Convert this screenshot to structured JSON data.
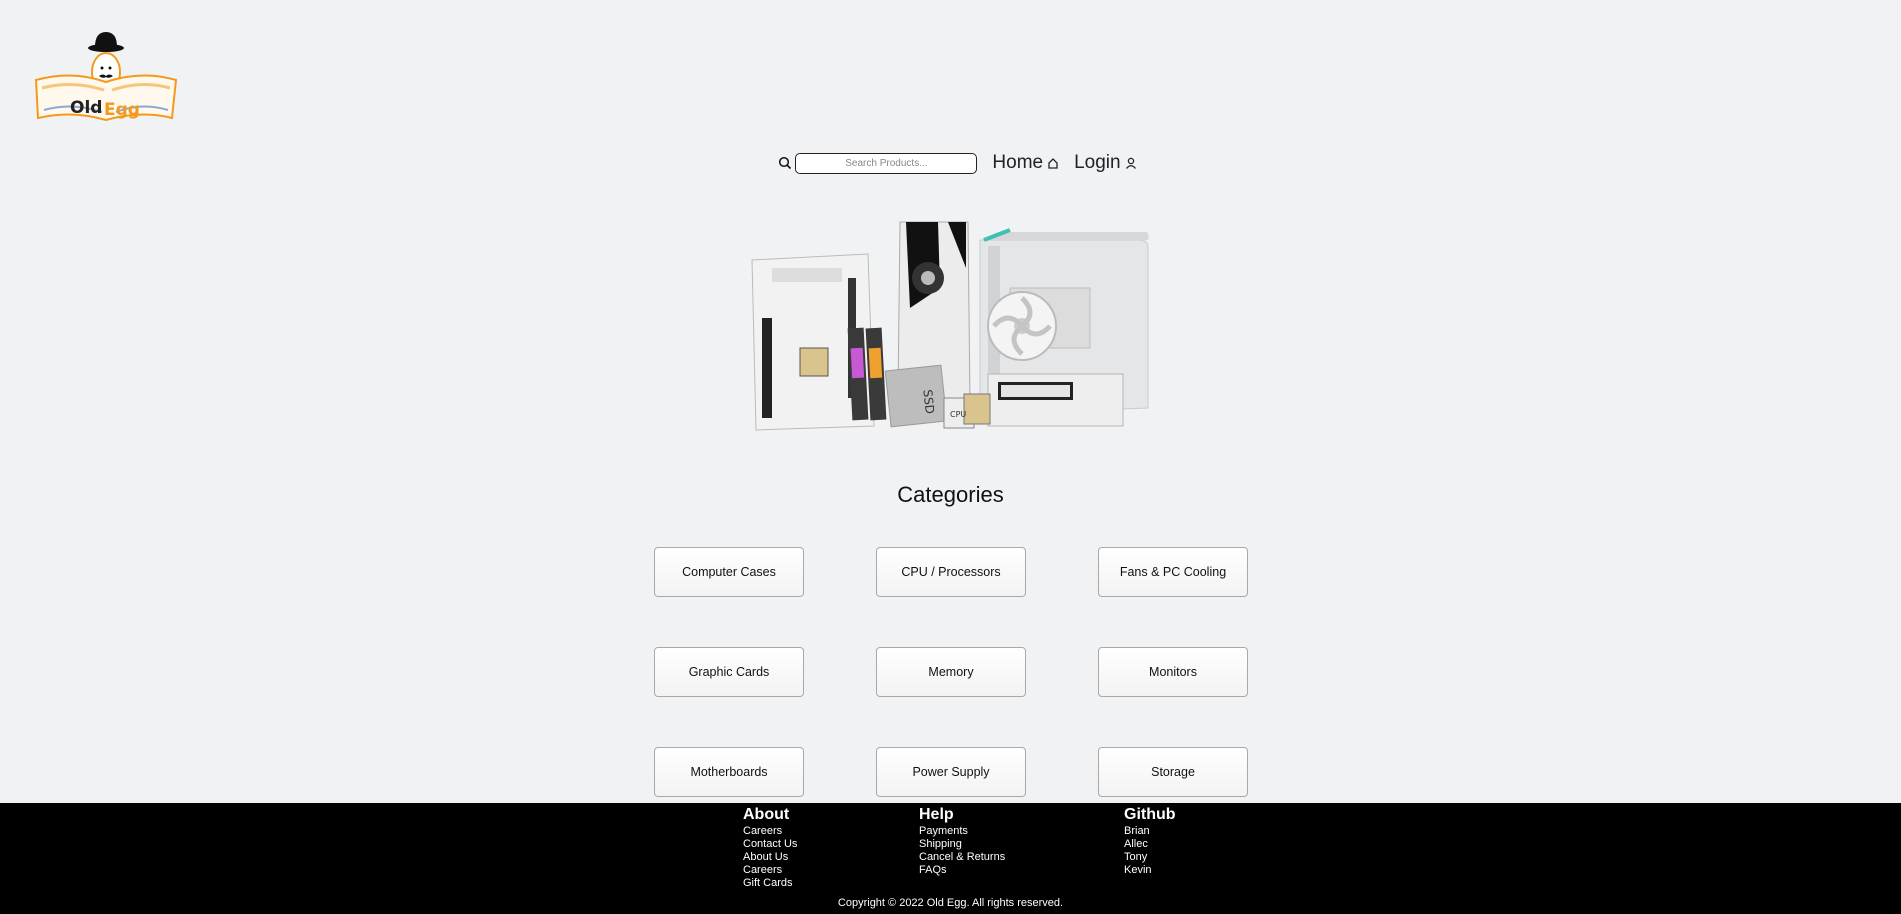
{
  "brand": {
    "name_part1": "Old",
    "name_part2": "Egg"
  },
  "nav": {
    "search_placeholder": "Search Products...",
    "home_label": "Home",
    "login_label": "Login"
  },
  "categories": {
    "title": "Categories",
    "items": [
      "Computer Cases",
      "CPU / Processors",
      "Fans & PC Cooling",
      "Graphic Cards",
      "Memory",
      "Monitors",
      "Motherboards",
      "Power Supply",
      "Storage"
    ]
  },
  "hero": {
    "ssd_label": "SSD",
    "cpu_label": "CPU"
  },
  "footer": {
    "about": {
      "title": "About",
      "links": [
        "Careers",
        "Contact Us",
        "About Us",
        "Careers",
        "Gift Cards"
      ]
    },
    "help": {
      "title": "Help",
      "links": [
        "Payments",
        "Shipping",
        "Cancel & Returns",
        "FAQs"
      ]
    },
    "github": {
      "title": "Github",
      "links": [
        "Brian",
        "Allec",
        "Tony",
        "Kevin"
      ]
    },
    "copyright": "Copyright © 2022 Old Egg. All rights reserved."
  },
  "colors": {
    "background": "#f1f2f4",
    "footer": "#000000",
    "logo_orange": "#f39a1e"
  }
}
